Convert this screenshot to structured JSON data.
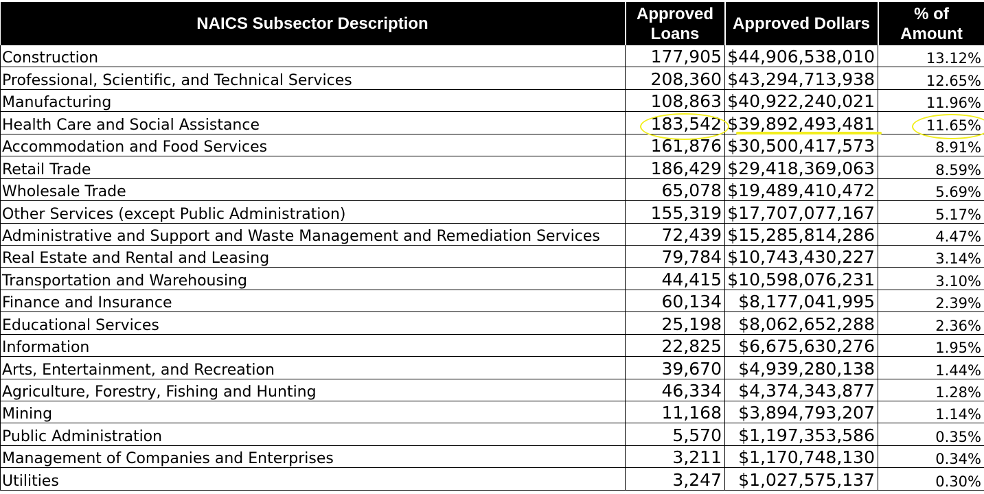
{
  "headers": {
    "description": "NAICS Subsector Description",
    "loans_line1": "Approved",
    "loans_line2": "Loans",
    "dollars": "Approved Dollars",
    "pct_line1": "% of",
    "pct_line2": "Amount"
  },
  "rows": [
    {
      "description": "Construction",
      "loans": "177,905",
      "dollars": "$44,906,538,010",
      "pct": "13.12%"
    },
    {
      "description": "Professional, Scientific, and Technical Services",
      "loans": "208,360",
      "dollars": "$43,294,713,938",
      "pct": "12.65%"
    },
    {
      "description": "Manufacturing",
      "loans": "108,863",
      "dollars": "$40,922,240,021",
      "pct": "11.96%"
    },
    {
      "description": "Health Care and Social Assistance",
      "loans": "183,542",
      "dollars": "$39,892,493,481",
      "pct": "11.65%"
    },
    {
      "description": "Accommodation and Food Services",
      "loans": "161,876",
      "dollars": "$30,500,417,573",
      "pct": "8.91%"
    },
    {
      "description": "Retail Trade",
      "loans": "186,429",
      "dollars": "$29,418,369,063",
      "pct": "8.59%"
    },
    {
      "description": "Wholesale Trade",
      "loans": "65,078",
      "dollars": "$19,489,410,472",
      "pct": "5.69%"
    },
    {
      "description": "Other Services (except Public Administration)",
      "loans": "155,319",
      "dollars": "$17,707,077,167",
      "pct": "5.17%"
    },
    {
      "description": "Administrative and Support and Waste Management and Remediation Services",
      "loans": "72,439",
      "dollars": "$15,285,814,286",
      "pct": "4.47%"
    },
    {
      "description": "Real Estate and Rental and Leasing",
      "loans": "79,784",
      "dollars": "$10,743,430,227",
      "pct": "3.14%"
    },
    {
      "description": "Transportation and Warehousing",
      "loans": "44,415",
      "dollars": "$10,598,076,231",
      "pct": "3.10%"
    },
    {
      "description": "Finance and Insurance",
      "loans": "60,134",
      "dollars": "$8,177,041,995",
      "pct": "2.39%"
    },
    {
      "description": "Educational Services",
      "loans": "25,198",
      "dollars": "$8,062,652,288",
      "pct": "2.36%"
    },
    {
      "description": "Information",
      "loans": "22,825",
      "dollars": "$6,675,630,276",
      "pct": "1.95%"
    },
    {
      "description": "Arts, Entertainment, and Recreation",
      "loans": "39,670",
      "dollars": "$4,939,280,138",
      "pct": "1.44%"
    },
    {
      "description": "Agriculture, Forestry, Fishing and Hunting",
      "loans": "46,334",
      "dollars": "$4,374,343,877",
      "pct": "1.28%"
    },
    {
      "description": "Mining",
      "loans": "11,168",
      "dollars": "$3,894,793,207",
      "pct": "1.14%"
    },
    {
      "description": "Public Administration",
      "loans": "5,570",
      "dollars": "$1,197,353,586",
      "pct": "0.35%"
    },
    {
      "description": "Management of Companies and Enterprises",
      "loans": "3,211",
      "dollars": "$1,170,748,130",
      "pct": "0.34%"
    },
    {
      "description": "Utilities",
      "loans": "3,247",
      "dollars": "$1,027,575,137",
      "pct": "0.30%"
    }
  ],
  "highlight": {
    "row": "Health Care and Social Assistance",
    "color": "#f2ee1f"
  },
  "colors": {
    "header_bg": "#000000",
    "header_text": "#ffffff",
    "grid": "#000000"
  }
}
